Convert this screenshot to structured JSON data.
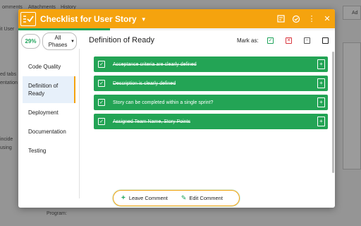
{
  "background": {
    "tabs": [
      "omments",
      "Attachments",
      "History"
    ],
    "left_texts": [
      "it User",
      "ed tabs",
      "entation",
      "incide",
      "using"
    ],
    "program_label": "Program:",
    "right_label": "Ad"
  },
  "modal": {
    "title": "Checklist for User Story",
    "progress_fraction": 0.29,
    "header_icons": [
      "checklist-icon",
      "check-add-icon",
      "more-vertical-icon",
      "close-icon"
    ]
  },
  "sidebar": {
    "percent": "29%",
    "phase_select": {
      "line1": "All",
      "line2": "Phases"
    },
    "items": [
      {
        "label": "Code Quality",
        "active": false
      },
      {
        "label": "Definition of Ready",
        "active": true
      },
      {
        "label": "Deployment",
        "active": false
      },
      {
        "label": "Documentation",
        "active": false
      },
      {
        "label": "Testing",
        "active": false
      }
    ]
  },
  "content": {
    "section_title": "Definition of Ready",
    "mark_as_label": "Mark as:",
    "colors": {
      "accent": "#f5a30e",
      "item_green": "#23a455",
      "mark_green": "#1ea35a",
      "mark_red": "#d9363e"
    },
    "items": [
      {
        "text": "Acceptance criteria are clearly defined",
        "struck": true
      },
      {
        "text": "Description is clearly defined",
        "struck": true
      },
      {
        "text": "Story can be completed within a single sprint?",
        "struck": false
      },
      {
        "text": "Assigned Team Name, Story Points",
        "struck": true
      }
    ]
  },
  "footer": {
    "leave_comment": "Leave Comment",
    "edit_comment": "Edit Comment"
  }
}
